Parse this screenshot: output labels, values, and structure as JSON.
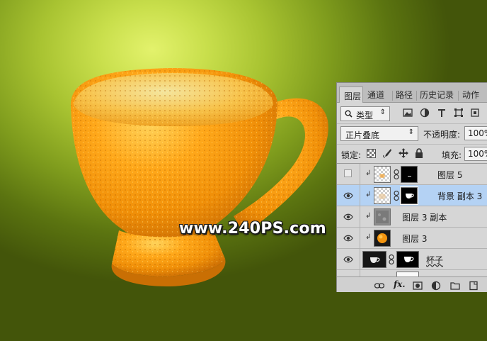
{
  "canvas": {
    "background_colors": [
      "#e3f26c",
      "#a8c331",
      "#43550a"
    ],
    "watermark": "www.240PS.com"
  },
  "layers_panel": {
    "tabs": [
      {
        "label": "图层",
        "active": true
      },
      {
        "label": "通道",
        "active": false
      },
      {
        "label": "路径",
        "active": false
      },
      {
        "label": "历史记录",
        "active": false
      },
      {
        "label": "动作",
        "active": false
      }
    ],
    "filter": {
      "kind_label": "类型",
      "icons": [
        "image-filter-icon",
        "adjustment-filter-icon",
        "type-filter-icon",
        "shape-filter-icon",
        "smart-object-filter-icon"
      ]
    },
    "blend_mode": "正片叠底",
    "opacity_label": "不透明度:",
    "opacity_value": "100%",
    "lock_label": "锁定:",
    "fill_label": "填充:",
    "fill_value": "100%",
    "layers": [
      {
        "name": "图层 5",
        "visible": false,
        "clipped": true,
        "has_mask": true,
        "selected": false
      },
      {
        "name": "背景 副本 3",
        "visible": true,
        "clipped": true,
        "has_mask": true,
        "selected": true
      },
      {
        "name": "图层 3 副本",
        "visible": true,
        "clipped": true,
        "has_mask": false,
        "selected": false
      },
      {
        "name": "图层 3",
        "visible": true,
        "clipped": true,
        "has_mask": false,
        "selected": false
      },
      {
        "name": "杯子",
        "visible": true,
        "clipped": false,
        "has_mask": true,
        "selected": false
      }
    ],
    "bottom_icons": [
      "link-layers-icon",
      "fx-icon",
      "add-mask-icon",
      "adjustment-layer-icon",
      "new-group-icon",
      "new-layer-icon"
    ],
    "bottom_fx_text": "fx.",
    "accent_selected": "#b4d2f4"
  }
}
